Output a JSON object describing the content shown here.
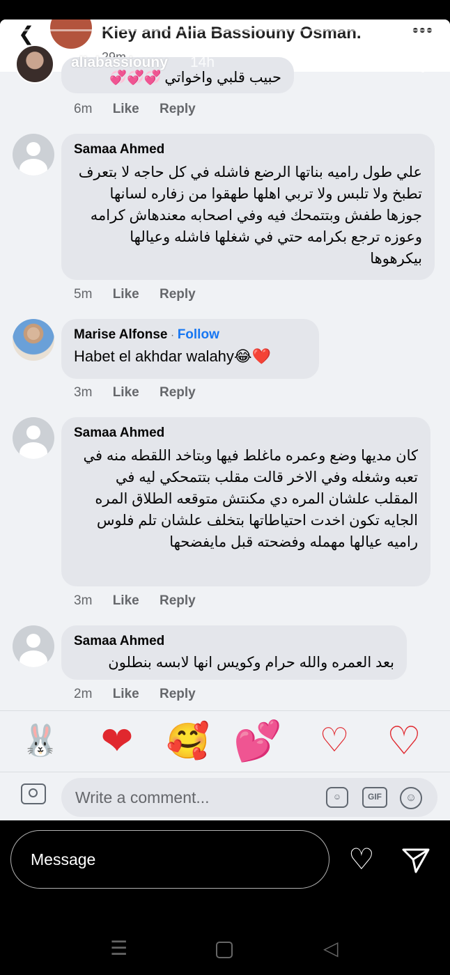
{
  "fb_header": {
    "back_icon": "back-arrow-icon",
    "page_name": "Kiey and Alia Bassiouny Osman.",
    "time": "29m",
    "more_icon": "more-dots-icon"
  },
  "story": {
    "username": "aliabassiouny",
    "time": "14h",
    "more_icon": "vertical-dots-icon"
  },
  "comments": [
    {
      "author": "",
      "text": "حبيب قلبي واخواتي",
      "time": "6m",
      "like": "Like",
      "reply": "Reply"
    },
    {
      "author": "Samaa Ahmed",
      "text": "علي طول راميه بناتها الرضع فاشله في كل حاجه لا بتعرف تطبخ ولا تلبس ولا تربي اهلها طهقوا من زفاره لسانها جوزها طفش وبتتمحك فيه وفي اصحابه معندهاش كرامه وعوزه ترجع بكرامه حتي في شغلها فاشله وعيالها بيكرهوها",
      "time": "5m",
      "like": "Like",
      "reply": "Reply"
    },
    {
      "author": "Marise Alfonse",
      "follow": "Follow",
      "text": "Habet el akhdar walahy😂❤️",
      "time": "3m",
      "like": "Like",
      "reply": "Reply"
    },
    {
      "author": "Samaa Ahmed",
      "text": "كان مديها وضع وعمره ماغلط فيها وبتاخد اللقطه منه في تعبه وشغله وفي الاخر قالت مقلب بتتمحكي ليه في المقلب علشان المره دي مكنتش متوقعه الطلاق المره الجايه تكون اخدت احتياطاتها بتخلف علشان تلم فلوس راميه عيالها مهمله وفضحته قبل مايفضحها",
      "time": "3m",
      "like": "Like",
      "reply": "Reply"
    },
    {
      "author": "Samaa Ahmed",
      "text": "بعد العمره والله حرام وكويس انها لابسه بنطلون",
      "time": "2m",
      "like": "Like",
      "reply": "Reply"
    }
  ],
  "stickers": [
    "bunny-hearts-sticker",
    "red-heart-sticker",
    "girl-heart-sticker",
    "pink-red-hearts-sticker",
    "small-red-heart-sticker",
    "outline-red-heart-sticker"
  ],
  "composer": {
    "placeholder": "Write a comment...",
    "gif": "GIF"
  },
  "ig_bar": {
    "message_placeholder": "Message"
  },
  "colors": {
    "accent": "#1877f2",
    "bubble": "#e4e6eb"
  }
}
